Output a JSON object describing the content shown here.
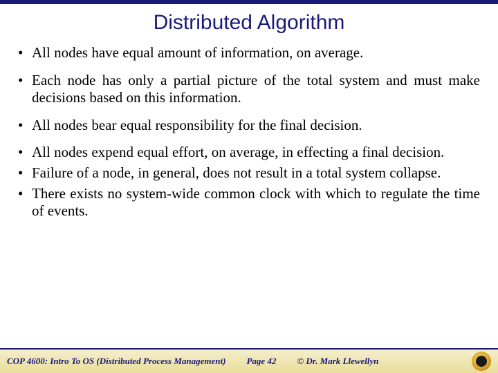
{
  "title": "Distributed Algorithm",
  "bullets": [
    "All nodes have equal amount of information, on average.",
    "Each node has only a partial picture of the total system and must make decisions based on this information.",
    "All nodes bear equal responsibility for the final decision.",
    "All nodes expend equal effort, on average, in effecting a final decision.",
    "Failure of a node, in general, does not result in a total system collapse.",
    "There exists no system-wide common clock with which to regulate the time of events."
  ],
  "footer": {
    "course": "COP 4600: Intro To OS  (Distributed Process Management)",
    "page": "Page 42",
    "author": "© Dr. Mark Llewellyn"
  }
}
